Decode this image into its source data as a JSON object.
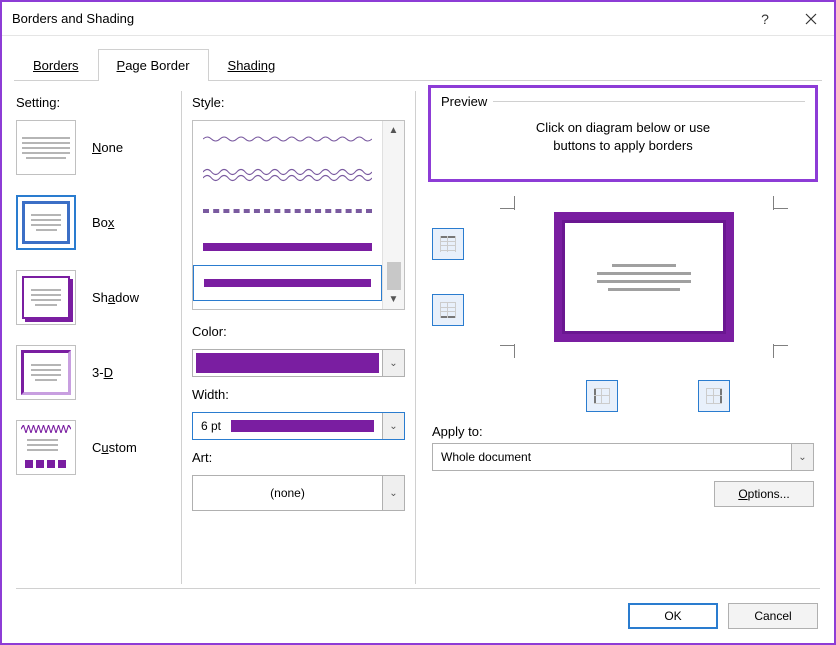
{
  "window": {
    "title": "Borders and Shading"
  },
  "tabs": {
    "borders": "Borders",
    "page_border": "Page Border",
    "shading": "Shading",
    "active": "page_border"
  },
  "setting": {
    "label": "Setting:",
    "items": [
      {
        "label": "None",
        "key": "N"
      },
      {
        "label": "Box",
        "key": "x"
      },
      {
        "label": "Shadow",
        "key": "a"
      },
      {
        "label": "3-D",
        "key": "D"
      },
      {
        "label": "Custom",
        "key": "u"
      }
    ],
    "selected": 1
  },
  "style": {
    "label": "Style:",
    "color_label": "Color:",
    "color_value": "#7a1ea1",
    "width_label": "Width:",
    "width_value": "6 pt",
    "art_label": "Art:",
    "art_value": "(none)"
  },
  "preview": {
    "label": "Preview",
    "msg_l1": "Click on diagram below or use",
    "msg_l2": "buttons to apply borders",
    "apply_to_label": "Apply to:",
    "apply_to_value": "Whole document",
    "options_label": "Options..."
  },
  "footer": {
    "ok": "OK",
    "cancel": "Cancel"
  }
}
